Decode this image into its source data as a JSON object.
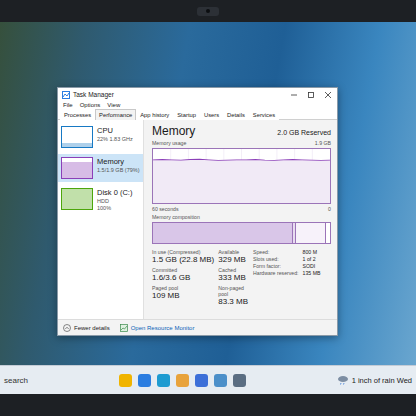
{
  "window": {
    "title": "Task Manager"
  },
  "menu": [
    "File",
    "Options",
    "View"
  ],
  "tabs": [
    {
      "label": "Processes",
      "selected": false
    },
    {
      "label": "Performance",
      "selected": true
    },
    {
      "label": "App history",
      "selected": false
    },
    {
      "label": "Startup",
      "selected": false
    },
    {
      "label": "Users",
      "selected": false
    },
    {
      "label": "Details",
      "selected": false
    },
    {
      "label": "Services",
      "selected": false
    }
  ],
  "sidebar": {
    "items": [
      {
        "name": "CPU",
        "details": [
          "22% 1.83 GHz"
        ],
        "selected": false,
        "level": 0.22,
        "color": "#1779c4"
      },
      {
        "name": "Memory",
        "details": [
          "1.5/1.9 GB (79%)"
        ],
        "selected": true,
        "level": 0.79,
        "color": "#8b3fb8"
      },
      {
        "name": "Disk 0 (C:)",
        "details": [
          "HDD",
          "100%"
        ],
        "selected": false,
        "level": 1.0,
        "color": "#4da60c"
      }
    ]
  },
  "main": {
    "title": "Memory",
    "total": "2.0 GB Reserved",
    "usage_chart": {
      "label": "Memory usage",
      "max": "1.9 GB",
      "axis_max": 1.9,
      "time": "60 seconds",
      "min": "0",
      "values": [
        1.52,
        1.53,
        1.52,
        1.51,
        1.53,
        1.54,
        1.52,
        1.5,
        1.51,
        1.52,
        1.52,
        1.53,
        1.51,
        1.5,
        1.52,
        1.53,
        1.52,
        1.51,
        1.5,
        1.51
      ]
    },
    "composition": {
      "label": "Memory composition",
      "in_use": 0.79,
      "modified": 0.02,
      "standby": 0.17
    },
    "stats": [
      {
        "label": "In use (Compressed)",
        "value": "1.5 GB (22.8 MB)"
      },
      {
        "label": "Available",
        "value": "329 MB"
      },
      {
        "label": "Committed",
        "value": "1.6/3.6 GB"
      },
      {
        "label": "Cached",
        "value": "333 MB"
      },
      {
        "label": "Paged pool",
        "value": "109 MB"
      },
      {
        "label": "Non-paged pool",
        "value": "83.3 MB"
      }
    ],
    "specs": [
      {
        "label": "Speed:",
        "value": "800 M"
      },
      {
        "label": "Slots used:",
        "value": "1 of 2"
      },
      {
        "label": "Form factor:",
        "value": "SODI"
      },
      {
        "label": "Hardware reserved:",
        "value": "135 MB"
      }
    ]
  },
  "footer": {
    "fewer": "Fewer details",
    "monitor": "Open Resource Monitor"
  },
  "taskbar": {
    "search": "search",
    "weather": "1 inch of rain Wed"
  }
}
